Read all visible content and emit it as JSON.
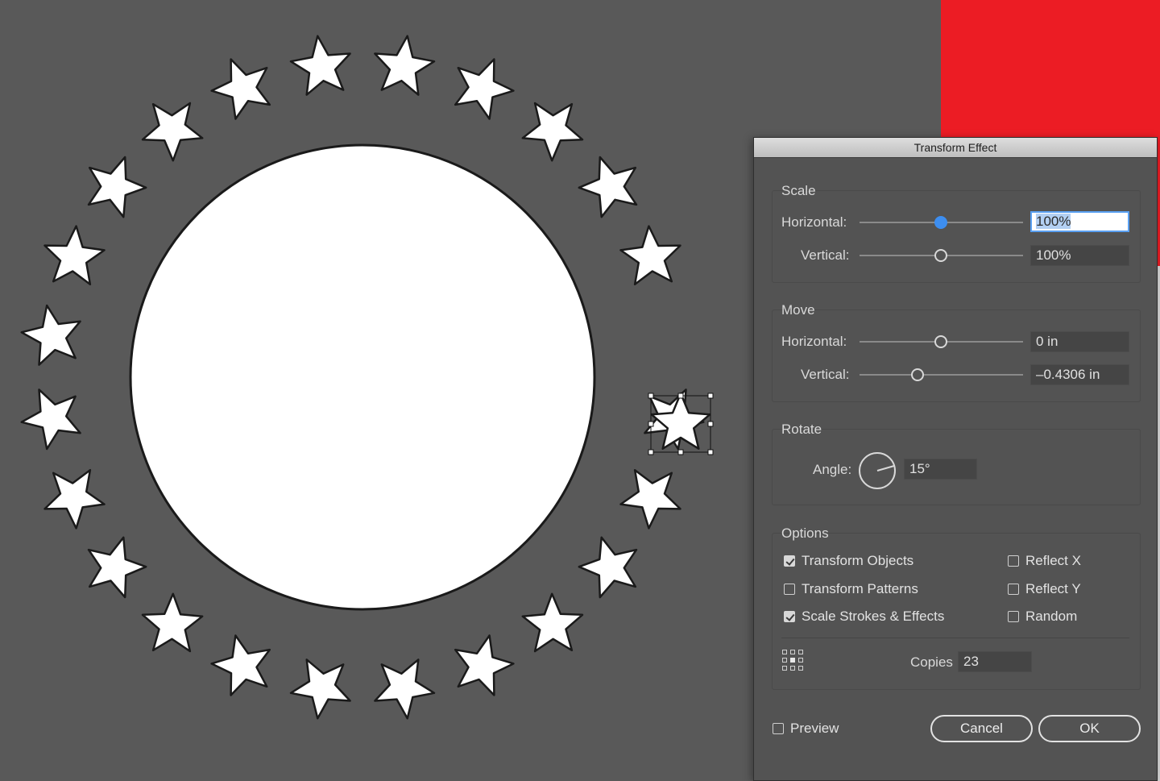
{
  "canvas": {
    "star_ring_count": 24,
    "colors": {
      "background": "#595959",
      "shape_fill": "#ffffff",
      "outline": "#1a1a1a",
      "red_block": "#ec1c24"
    }
  },
  "dialog": {
    "title": "Transform Effect",
    "scale": {
      "label": "Scale",
      "horizontal_label": "Horizontal:",
      "horizontal_value": "100%",
      "vertical_label": "Vertical:",
      "vertical_value": "100%"
    },
    "move": {
      "label": "Move",
      "horizontal_label": "Horizontal:",
      "horizontal_value": "0 in",
      "vertical_label": "Vertical:",
      "vertical_value": "–0.4306 in"
    },
    "rotate": {
      "label": "Rotate",
      "angle_label": "Angle:",
      "angle_value": "15°"
    },
    "options": {
      "label": "Options",
      "transform_objects": {
        "label": "Transform Objects",
        "checked": true
      },
      "transform_patterns": {
        "label": "Transform Patterns",
        "checked": false
      },
      "scale_strokes": {
        "label": "Scale Strokes & Effects",
        "checked": true
      },
      "reflect_x": {
        "label": "Reflect X",
        "checked": false
      },
      "reflect_y": {
        "label": "Reflect Y",
        "checked": false
      },
      "random": {
        "label": "Random",
        "checked": false
      },
      "reference_point_icon": "reference-point-grid-icon",
      "copies_label": "Copies",
      "copies_value": "23"
    },
    "preview": {
      "label": "Preview",
      "checked": false
    },
    "cancel_label": "Cancel",
    "ok_label": "OK"
  }
}
